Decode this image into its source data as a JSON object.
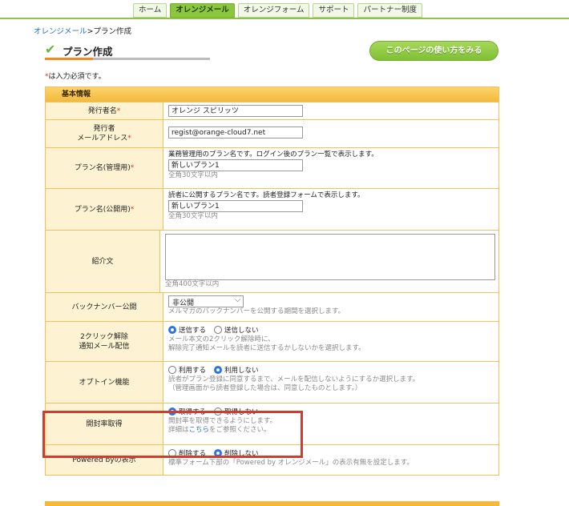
{
  "nav": {
    "tabs": [
      {
        "label": "ホーム",
        "active": false
      },
      {
        "label": "オレンジメール",
        "active": true
      },
      {
        "label": "オレンジフォーム",
        "active": false
      },
      {
        "label": "サポート",
        "active": false
      },
      {
        "label": "パートナー制度",
        "active": false
      }
    ]
  },
  "breadcrumb": {
    "parent": "オレンジメール",
    "separator": ">",
    "current": "プラン作成"
  },
  "page": {
    "title": "プラン作成",
    "howto_button": "このページの使い方をみる",
    "required_star": "*",
    "required_note": "は入力必須です。"
  },
  "section": {
    "title": "基本情報"
  },
  "fields": {
    "issuer_name": {
      "label": "発行者名",
      "star": "*",
      "value": "オレンジ スピリッツ"
    },
    "issuer_email": {
      "label_line1": "発行者",
      "label_line2": "メールアドレス",
      "star": "*",
      "value": "regist@orange-cloud7.net"
    },
    "plan_name_admin": {
      "label": "プラン名(管理用)",
      "star": "*",
      "desc": "業務管理用のプラン名です。ログイン後のプラン一覧で表示します。",
      "value": "新しいプラン1",
      "hint": "全角30文字以内"
    },
    "plan_name_public": {
      "label": "プラン名(公開用)",
      "star": "*",
      "desc": "読者に公開するプラン名です。読者登録フォームで表示します。",
      "value": "新しいプラン1",
      "hint": "全角30文字以内"
    },
    "intro": {
      "label": "紹介文",
      "value": "",
      "hint": "全角400文字以内"
    },
    "backnumber": {
      "label": "バックナンバー公開",
      "selected": "非公開",
      "note": "メルマガのバックナンバーを公開する期間を選択します。"
    },
    "two_click": {
      "label_line1": "2クリック解除",
      "label_line2": "通知メール配信",
      "opt_on": "送信する",
      "opt_off": "送信しない",
      "selected": "送信する",
      "note_line1": "メール本文の2クリック解除時に、",
      "note_line2": "解除完了通知メールを読者に送信するかしないかを選択します。"
    },
    "optin": {
      "label": "オプトイン機能",
      "opt_on": "利用する",
      "opt_off": "利用しない",
      "selected": "利用しない",
      "note_line1": "読者がプラン登録に同意するまで、メールを配信しないようにするか選択します。",
      "note_line2": "（管理画面から読者登録した場合は、同意したものとします。）"
    },
    "open_rate": {
      "label": "開封率取得",
      "opt_on": "取得する",
      "opt_off": "取得しない",
      "selected": "取得する",
      "note_line1": "開封率を取得できるようにします。",
      "note_prefix": "詳細は",
      "note_link": "こちら",
      "note_suffix": "をご参照ください。"
    },
    "powered_by": {
      "label": "Powered byの表示",
      "opt_on": "削除する",
      "opt_off": "削除しない",
      "selected": "削除しない",
      "note": "標準フォーム下部の「Powered by オレンジメール」の表示有無を設定します。"
    }
  },
  "colors": {
    "accent_green": "#8cc63e",
    "accent_orange": "#f4b93a",
    "highlight_red": "#d23b2f",
    "link_blue": "#2a73c6"
  }
}
